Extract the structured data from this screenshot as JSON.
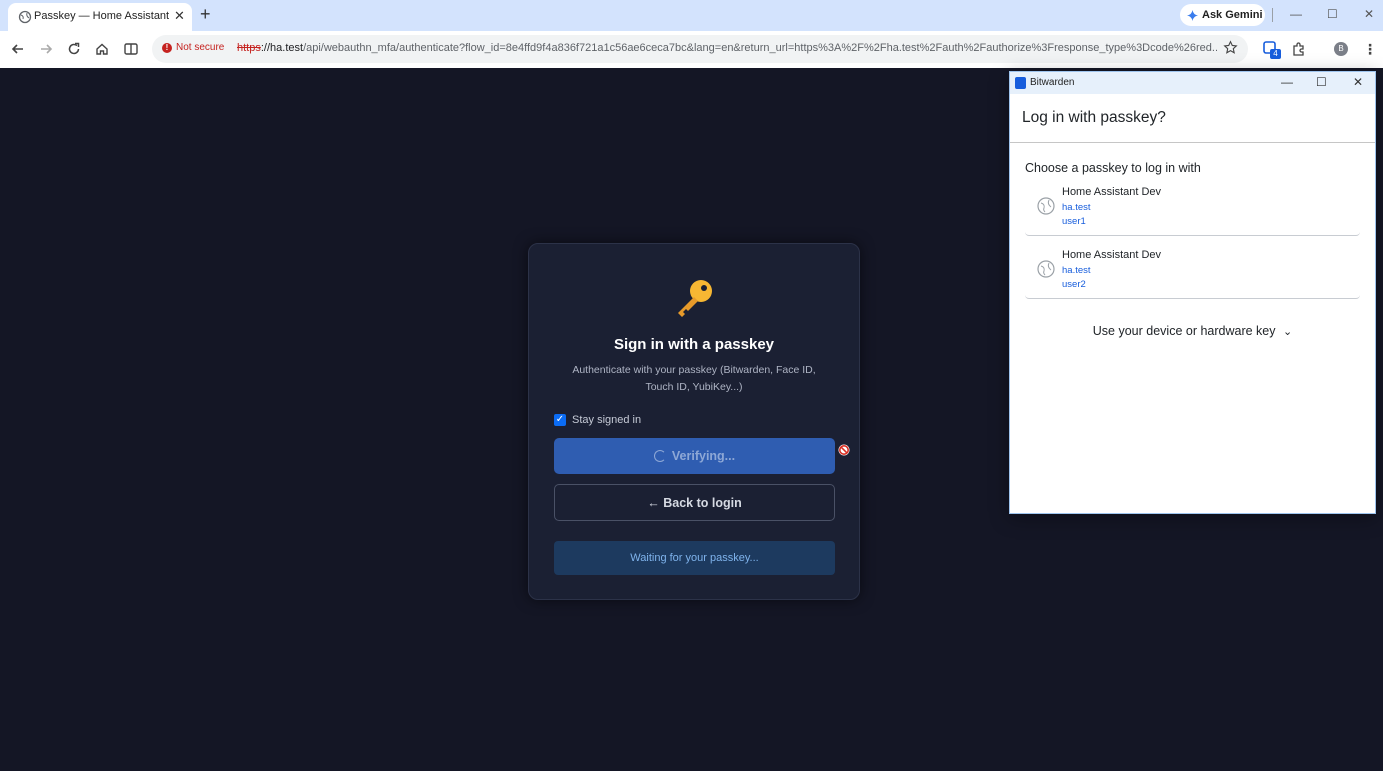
{
  "browser": {
    "tab_title": "Passkey — Home Assistant",
    "tab_close": "✕",
    "new_tab": "+",
    "ask_gemini": "Ask Gemini",
    "not_secure": "Not secure",
    "url_scheme": "https",
    "url_host": "://ha.test",
    "url_path": "/api/webauthn_mfa/authenticate?flow_id=8e4ffd9f4a836f721a1c56ae6ceca7bc&lang=en&return_url=https%3A%2F%2Fha.test%2Fauth%2Fauthorize%3Fresponse_type%3Dcode%26red...",
    "extension_badge": "4",
    "profile_initial": "B"
  },
  "card": {
    "title": "Sign in with a passkey",
    "description": "Authenticate with your passkey (Bitwarden, Face ID, Touch ID, YubiKey...)",
    "stay_signed_in": "Stay signed in",
    "stay_signed_in_checked": true,
    "verify_label": "Verifying...",
    "back_label": "← Back to login",
    "waiting_text": "Waiting for your passkey..."
  },
  "bitwarden": {
    "app_name": "Bitwarden",
    "title": "Log in with passkey?",
    "choose_label": "Choose a passkey to log in with",
    "passkeys": [
      {
        "name": "Home Assistant Dev",
        "site": "ha.test",
        "user": "user1"
      },
      {
        "name": "Home Assistant Dev",
        "site": "ha.test",
        "user": "user2"
      }
    ],
    "device_option": "Use your device or hardware key",
    "device_chevron": "⌄"
  },
  "colors": {
    "page_bg": "#141625",
    "card_bg": "#1b2033",
    "primary_button": "#2f5db1",
    "info_banner": "#1d3a5f",
    "bitwarden_blue": "#175ddc",
    "not_secure_red": "#c5221f"
  },
  "icons": {
    "tab_favicon": "globe-icon",
    "key": "key-icon",
    "blocked": "no-entry-icon",
    "passkey_item": "globe-icon"
  }
}
